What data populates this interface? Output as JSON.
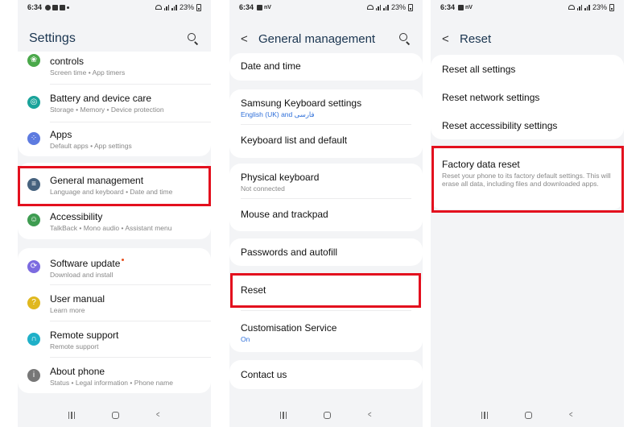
{
  "status": {
    "time": "6:34",
    "battery": "23%",
    "net": "nV",
    "volte": "Vo) LTE1"
  },
  "screen1": {
    "title": "Settings",
    "items": [
      {
        "title": "controls",
        "subtitle_a": "Screen time",
        "subtitle_b": "App timers"
      },
      {
        "title": "Battery and device care",
        "subtitle_a": "Storage",
        "subtitle_b": "Memory",
        "subtitle_c": "Device protection"
      },
      {
        "title": "Apps",
        "subtitle_a": "Default apps",
        "subtitle_b": "App settings"
      },
      {
        "title": "General management",
        "subtitle_a": "Language and keyboard",
        "subtitle_b": "Date and time"
      },
      {
        "title": "Accessibility",
        "subtitle_a": "TalkBack",
        "subtitle_b": "Mono audio",
        "subtitle_c": "Assistant menu"
      },
      {
        "title": "Software update",
        "subtitle_a": "Download and install"
      },
      {
        "title": "User manual",
        "subtitle_a": "Learn more"
      },
      {
        "title": "Remote support",
        "subtitle_a": "Remote support"
      },
      {
        "title": "About phone",
        "subtitle_a": "Status",
        "subtitle_b": "Legal information",
        "subtitle_c": "Phone name"
      }
    ]
  },
  "screen2": {
    "title": "General management",
    "items": [
      {
        "title": "Date and time"
      },
      {
        "title": "Samsung Keyboard settings",
        "subtitle_a": "English (UK) and فارسی"
      },
      {
        "title": "Keyboard list and default"
      },
      {
        "title": "Physical keyboard",
        "subtitle_a": "Not connected"
      },
      {
        "title": "Mouse and trackpad"
      },
      {
        "title": "Passwords and autofill"
      },
      {
        "title": "Reset"
      },
      {
        "title": "Customisation Service",
        "subtitle_a": "On"
      },
      {
        "title": "Contact us"
      }
    ]
  },
  "screen3": {
    "title": "Reset",
    "items": [
      {
        "title": "Reset all settings"
      },
      {
        "title": "Reset network settings"
      },
      {
        "title": "Reset accessibility settings"
      },
      {
        "title": "Factory data reset",
        "subtitle_a": "Reset your phone to its factory default settings. This will erase all data, including files and downloaded apps."
      }
    ]
  },
  "colors": {
    "highlight": "#e3101e",
    "accent_blue": "#2e6fd9",
    "title_navy": "#1a3550"
  },
  "icons": [
    "search-icon",
    "back-arrow-icon",
    "leaf-icon",
    "battery-care-icon",
    "apps-icon",
    "sliders-icon",
    "accessibility-icon",
    "update-icon",
    "manual-icon",
    "headset-icon",
    "info-icon"
  ]
}
